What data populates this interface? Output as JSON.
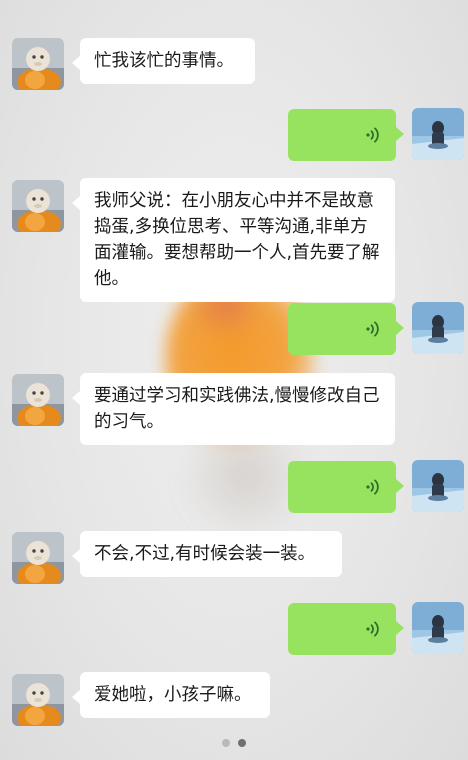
{
  "messages": [
    {
      "side": "left",
      "text": "忙我该忙的事情。"
    },
    {
      "side": "right",
      "type": "voice",
      "icon": "voice-wave-icon"
    },
    {
      "side": "left",
      "text": "我师父说：在小朋友心中并不是故意捣蛋,多换位思考、平等沟通,非单方面灌输。要想帮助一个人,首先要了解他。"
    },
    {
      "side": "right",
      "type": "voice",
      "icon": "voice-wave-icon"
    },
    {
      "side": "left",
      "text": "要通过学习和实践佛法,慢慢修改自己的习气。"
    },
    {
      "side": "right",
      "type": "voice",
      "icon": "voice-wave-icon"
    },
    {
      "side": "left",
      "text": "不会,不过,有时候会装一装。"
    },
    {
      "side": "right",
      "type": "voice",
      "icon": "voice-wave-icon"
    },
    {
      "side": "left",
      "text": "爱她啦，小孩子嘛。"
    }
  ],
  "pagination": {
    "total": 2,
    "current": 2
  },
  "colors": {
    "sent_bubble": "#97e35f",
    "received_bubble": "#ffffff",
    "voice_icon": "#2d6e2d"
  }
}
